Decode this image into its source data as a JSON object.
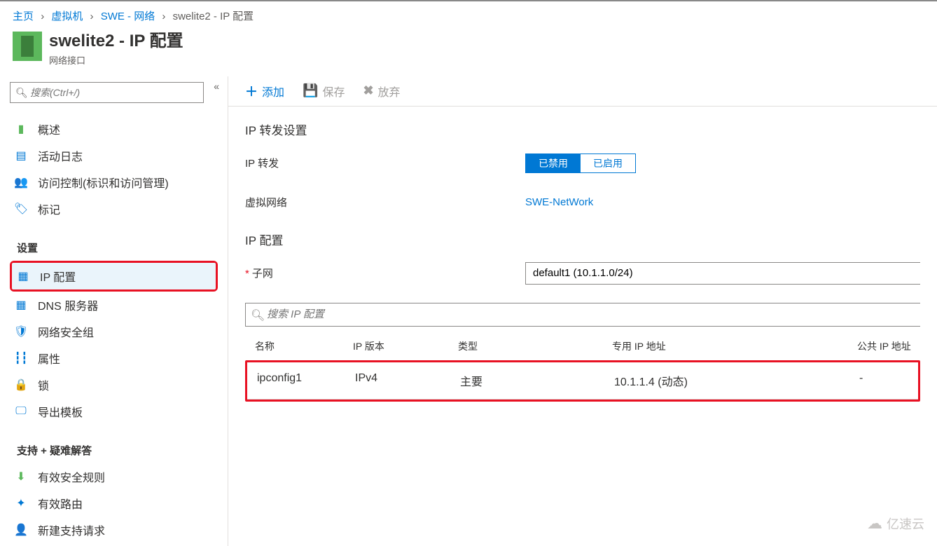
{
  "breadcrumb": {
    "home": "主页",
    "vm": "虚拟机",
    "net": "SWE - 网络",
    "current": "swelite2 - IP 配置"
  },
  "header": {
    "title": "swelite2 - IP 配置",
    "subtitle": "网络接口"
  },
  "sidebar": {
    "search_placeholder": "搜索(Ctrl+/)",
    "items_top": [
      {
        "icon": "overview-icon",
        "label": "概述"
      },
      {
        "icon": "activity-log-icon",
        "label": "活动日志"
      },
      {
        "icon": "access-control-icon",
        "label": "访问控制(标识和访问管理)"
      },
      {
        "icon": "tag-icon",
        "label": "标记"
      }
    ],
    "section_settings": "设置",
    "items_settings": [
      {
        "icon": "ip-config-icon",
        "label": "IP 配置",
        "active": true
      },
      {
        "icon": "dns-icon",
        "label": "DNS 服务器"
      },
      {
        "icon": "nsg-icon",
        "label": "网络安全组"
      },
      {
        "icon": "properties-icon",
        "label": "属性"
      },
      {
        "icon": "lock-icon",
        "label": "锁"
      },
      {
        "icon": "export-template-icon",
        "label": "导出模板"
      }
    ],
    "section_support": "支持 + 疑难解答",
    "items_support": [
      {
        "icon": "effective-rules-icon",
        "label": "有效安全规则"
      },
      {
        "icon": "effective-routes-icon",
        "label": "有效路由"
      },
      {
        "icon": "new-support-icon",
        "label": "新建支持请求"
      }
    ]
  },
  "toolbar": {
    "add": "添加",
    "save": "保存",
    "discard": "放弃"
  },
  "forwarding": {
    "title": "IP 转发设置",
    "label": "IP 转发",
    "disabled": "已禁用",
    "enabled": "已启用",
    "vnet_label": "虚拟网络",
    "vnet_value": "SWE-NetWork"
  },
  "ipconfig": {
    "title": "IP 配置",
    "subnet_label": "子网",
    "subnet_value": "default1 (10.1.1.0/24)",
    "search_placeholder": "搜索 IP 配置",
    "columns": {
      "name": "名称",
      "version": "IP 版本",
      "type": "类型",
      "private": "专用 IP 地址",
      "public": "公共 IP 地址"
    },
    "rows": [
      {
        "name": "ipconfig1",
        "version": "IPv4",
        "type": "主要",
        "private": "10.1.1.4 (动态)",
        "public": "-"
      }
    ]
  },
  "watermark": "亿速云"
}
